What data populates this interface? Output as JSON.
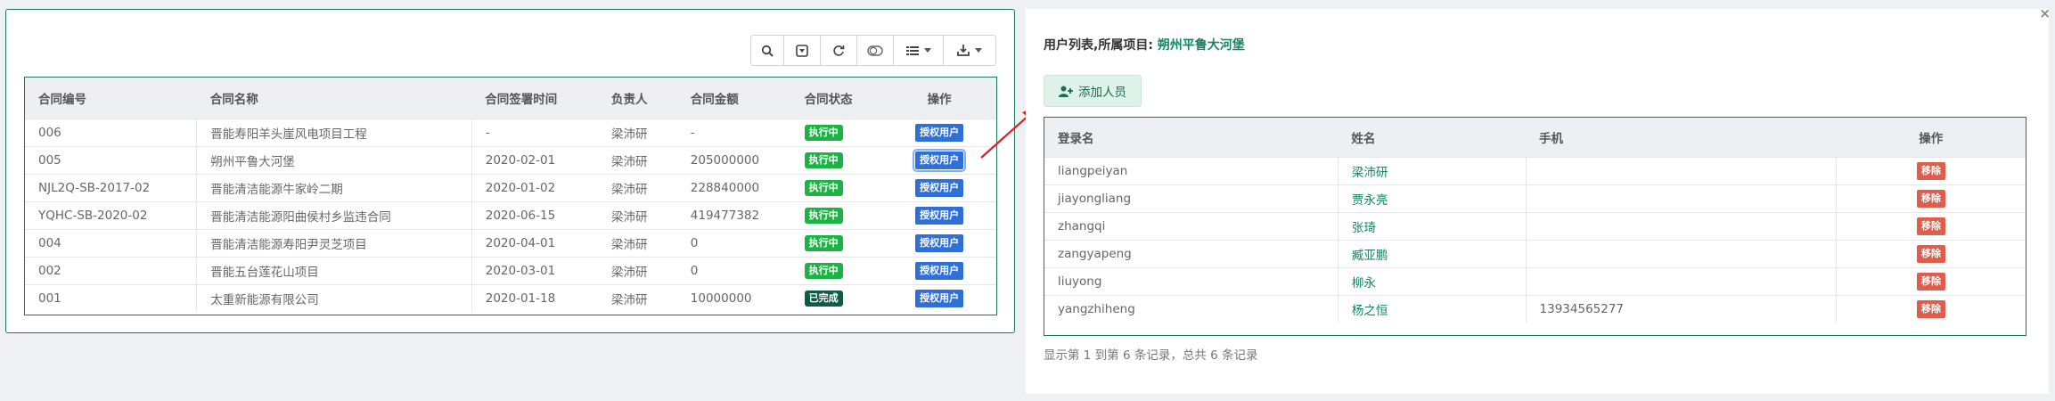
{
  "contract_toolbar": {
    "icons": [
      "search-icon",
      "toggle-icon",
      "refresh-icon",
      "switch-icon",
      "columns-icon",
      "export-icon"
    ]
  },
  "contract_table": {
    "headers": [
      "合同编号",
      "合同名称",
      "合同签署时间",
      "负责人",
      "合同金额",
      "合同状态",
      "操作"
    ],
    "rows": [
      {
        "code": "006",
        "name": "晋能寿阳羊头崖风电项目工程",
        "date": "-",
        "owner": "梁沛研",
        "amount": "-",
        "status": "执行中",
        "action": "授权用户"
      },
      {
        "code": "005",
        "name": "朔州平鲁大河堡",
        "date": "2020-02-01",
        "owner": "梁沛研",
        "amount": "205000000",
        "status": "执行中",
        "action": "授权用户"
      },
      {
        "code": "NJL2Q-SB-2017-02",
        "name": "晋能清洁能源牛家岭二期",
        "date": "2020-01-02",
        "owner": "梁沛研",
        "amount": "228840000",
        "status": "执行中",
        "action": "授权用户"
      },
      {
        "code": "YQHC-SB-2020-02",
        "name": "晋能清洁能源阳曲侯村乡监违合同",
        "date": "2020-06-15",
        "owner": "梁沛研",
        "amount": "419477382",
        "status": "执行中",
        "action": "授权用户"
      },
      {
        "code": "004",
        "name": "晋能清洁能源寿阳尹灵芝项目",
        "date": "2020-04-01",
        "owner": "梁沛研",
        "amount": "0",
        "status": "执行中",
        "action": "授权用户"
      },
      {
        "code": "002",
        "name": "晋能五台莲花山项目",
        "date": "2020-03-01",
        "owner": "梁沛研",
        "amount": "0",
        "status": "执行中",
        "action": "授权用户"
      },
      {
        "code": "001",
        "name": "太重新能源有限公司",
        "date": "2020-01-18",
        "owner": "梁沛研",
        "amount": "10000000",
        "status": "已完成",
        "action": "授权用户"
      }
    ]
  },
  "user_panel": {
    "title_prefix": "用户列表,所属项目: ",
    "project_name": "朔州平鲁大河堡",
    "add_label": "添加人员",
    "close_label": "×",
    "headers": [
      "登录名",
      "姓名",
      "手机",
      "操作"
    ],
    "rows": [
      {
        "login": "liangpeiyan",
        "name": "梁沛研",
        "phone": "",
        "action": "移除"
      },
      {
        "login": "jiayongliang",
        "name": "贾永亮",
        "phone": "",
        "action": "移除"
      },
      {
        "login": "zhangqi",
        "name": "张琦",
        "phone": "",
        "action": "移除"
      },
      {
        "login": "zangyapeng",
        "name": "臧亚鹏",
        "phone": "",
        "action": "移除"
      },
      {
        "login": "liuyong",
        "name": "柳永",
        "phone": "",
        "action": "移除"
      },
      {
        "login": "yangzhiheng",
        "name": "杨之恒",
        "phone": "13934565277",
        "action": "移除"
      }
    ],
    "pager_text": "显示第 1 到第 6 条记录，总共 6 条记录"
  },
  "colors": {
    "accent_green": "#1a7a5e",
    "running_badge": "#1ab344",
    "done_badge": "#0d5c46",
    "auth_button": "#2e6fd8",
    "remove_button": "#e05c4b",
    "arrow": "#e02020"
  }
}
